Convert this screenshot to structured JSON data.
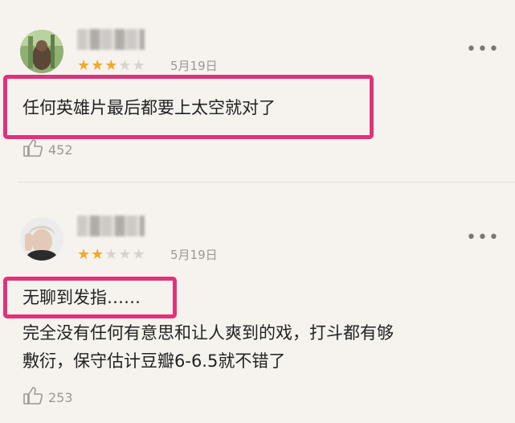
{
  "reviews": [
    {
      "rating": 3,
      "max_rating": 5,
      "date": "5月19日",
      "text_lines": [
        "任何英雄片最后都要上太空就对了"
      ],
      "likes": "452",
      "more": "•••"
    },
    {
      "rating": 2,
      "max_rating": 5,
      "date": "5月19日",
      "text_lines": [
        "无聊到发指……",
        "完全没有任何有意思和让人爽到的戏，打斗都有够",
        "敷衍，保守估计豆瓣6-6.5就不错了"
      ],
      "likes": "253",
      "more": "•••"
    }
  ],
  "colors": {
    "background": "#f6f3ef",
    "highlight": "#e0327a",
    "star": "#f0a830",
    "muted": "#9a9794"
  }
}
